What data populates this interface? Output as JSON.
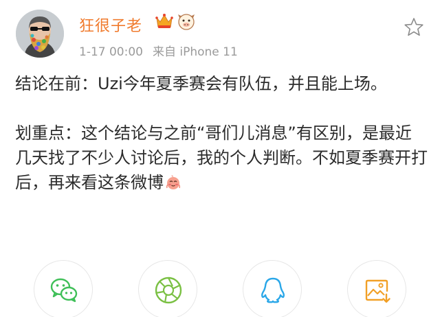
{
  "post": {
    "author": "狂很子老",
    "timestamp": "1-17 00:00",
    "source": "来自 iPhone 11",
    "paragraphs": [
      "结论在前：Uzi今年夏季赛会有队伍，并且能上场。",
      "划重点：这个结论与之前“哥们儿消息”有区别，是最近几天找了不少人讨论后，我的个人判断。不如夏季赛开打后，再来看这条微博"
    ]
  },
  "icons": {
    "avatar": "avatar-bearded-man",
    "badges": [
      "crown-icon",
      "cow-face-icon"
    ],
    "favorite": "star-outline-icon",
    "inline_emoji": "shy-face-emoji",
    "share": [
      "wechat-icon",
      "moments-icon",
      "qq-icon",
      "save-image-icon"
    ]
  },
  "colors": {
    "username": "#f07a2c",
    "meta": "#9a9a9a",
    "text": "#2b2b2b",
    "wechat": "#3fbf58",
    "moments": "#7ac043",
    "qq": "#2aa7e8",
    "save": "#f1a027"
  }
}
